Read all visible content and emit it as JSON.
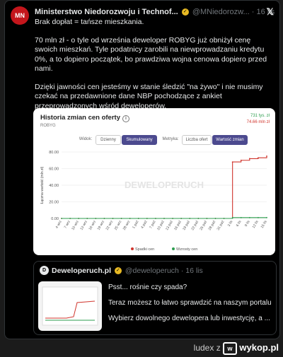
{
  "tweet": {
    "author": "Ministerstwo Niedorozwoju i Technof...",
    "handle": "@MNiedorozw...",
    "time": "16 lis",
    "paragraphs": [
      "Brak dopłat = tańsze mieszkania.",
      "70 mln zł - o tyle od września deweloper ROBYG już obniżył cenę swoich mieszkań. Tyle podatnicy zarobili na niewprowadzaniu kredytu 0%, a to dopiero początek, bo prawdziwa wojna cenowa dopiero przed nami.",
      "Dzięki jawności cen jesteśmy w stanie śledzić \"na żywo\" i nie musimy czekać na przedawnione dane NBP pochodzące z ankiet przeprowadzonych wśród deweloperów."
    ]
  },
  "card": {
    "title": "Historia zmian cen oferty",
    "subtitle": "ROBYG",
    "top_green": "731 tys. zł",
    "top_red": "74.66 mln zł",
    "controls": {
      "widok_label": "Widok:",
      "dzienny": "Dzienny",
      "skumulowany": "Skumulowany",
      "metryka_label": "Metryka:",
      "liczba": "Liczba ofert",
      "wartosc": "Wartość zmian"
    },
    "watermark": "DEWELOPERUCH"
  },
  "chart_data": {
    "type": "line",
    "ylabel": "Łączna wartość (mln zł)",
    "ylim": [
      0,
      80
    ],
    "yticks": [
      "0.00",
      "20.00",
      "40.00",
      "60.00",
      "80.00"
    ],
    "x": [
      "4 wrz",
      "7 wrz",
      "10 wrz",
      "13 wrz",
      "16 wrz",
      "19 wrz",
      "22 wrz",
      "25 wrz",
      "28 wrz",
      "1 paź",
      "4 paź",
      "7 paź",
      "10 paź",
      "13 paź",
      "16 paź",
      "19 paź",
      "22 paź",
      "25 paź",
      "28 paź",
      "31 paź",
      "3 lis",
      "6 lis",
      "9 lis",
      "12 lis",
      "15 lis"
    ],
    "series": [
      {
        "name": "Spadki cen",
        "color": "#d0342c",
        "values": [
          0,
          0,
          0,
          0,
          0,
          0,
          0,
          0,
          0,
          0,
          0,
          0,
          0,
          0,
          0,
          0,
          0,
          0,
          0,
          0,
          68,
          70,
          72,
          73,
          75
        ]
      },
      {
        "name": "Wzrosty cen",
        "color": "#2e9e4f",
        "values": [
          0,
          0,
          0,
          0,
          0,
          0,
          0,
          0,
          0,
          0,
          0,
          0,
          0,
          0,
          0,
          0,
          0,
          0,
          0,
          0,
          1,
          1,
          1,
          1,
          1
        ]
      }
    ],
    "grid": true,
    "legend": "bottom"
  },
  "quote": {
    "author": "Deweloperuch.pl",
    "handle": "@deweloperuch",
    "time": "16 lis",
    "lines": [
      "Psst... rośnie czy spada?",
      "Teraz możesz to łatwo sprawdzić na naszym portalu!",
      "Wybierz dowolnego dewelopera lub inwestycję, a ..."
    ]
  },
  "footer": {
    "user": "ludex",
    "z": "z",
    "site": "wykop.pl"
  }
}
